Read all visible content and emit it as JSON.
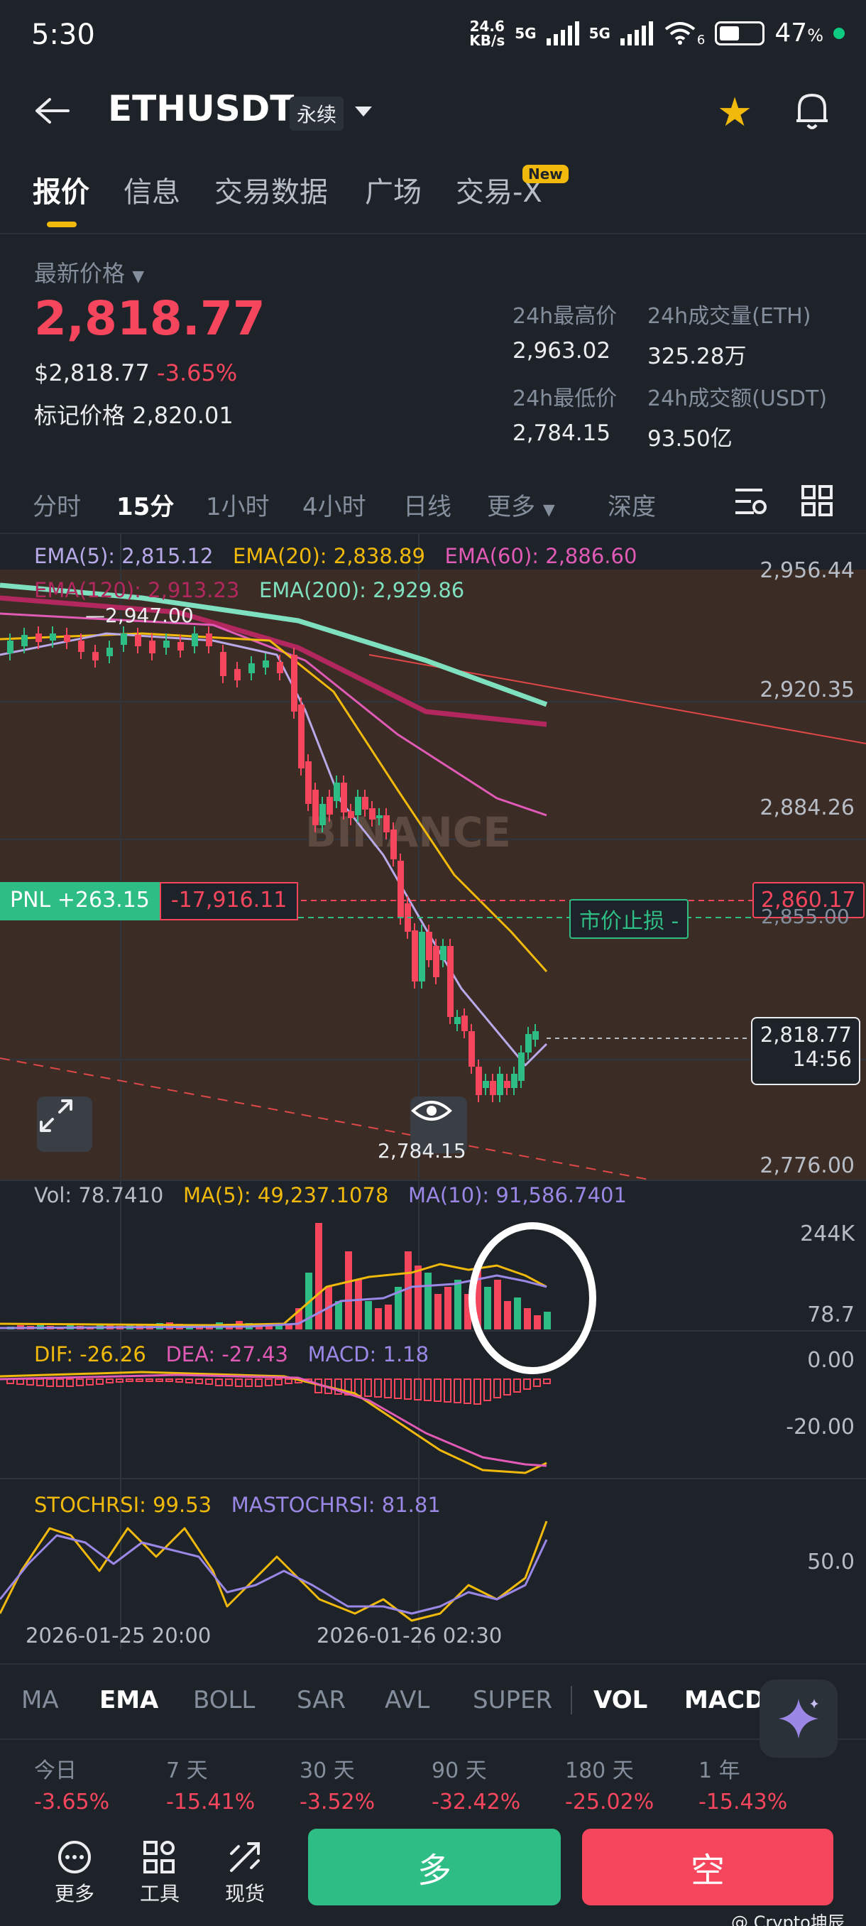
{
  "status_bar": {
    "time": "5:30",
    "net_speed_value": "24.6",
    "net_speed_unit": "KB/s",
    "signal1": "5G",
    "signal2": "5G",
    "wifi_badge": "6",
    "battery_percent": "47",
    "battery_unit": "%",
    "battery_level": 0.47
  },
  "header": {
    "symbol": "ETHUSDT",
    "contract_type": "永续"
  },
  "tabs": [
    {
      "label": "报价",
      "active": true
    },
    {
      "label": "信息"
    },
    {
      "label": "交易数据"
    },
    {
      "label": "广场"
    },
    {
      "label": "交易-X",
      "badge": "New"
    }
  ],
  "price": {
    "latest_label": "最新价格",
    "latest": "2,818.77",
    "usd": "$2,818.77",
    "change": "-3.65%",
    "mark_label": "标记价格",
    "mark": "2,820.01",
    "high_label": "24h最高价",
    "high": "2,963.02",
    "vol_eth_label": "24h成交量(ETH)",
    "vol_eth": "325.28万",
    "low_label": "24h最低价",
    "low": "2,784.15",
    "vol_usdt_label": "24h成交额(USDT)",
    "vol_usdt": "93.50亿"
  },
  "timeframes": [
    {
      "label": "分时"
    },
    {
      "label": "15分",
      "active": true
    },
    {
      "label": "1小时"
    },
    {
      "label": "4小时"
    },
    {
      "label": "日线"
    },
    {
      "label": "更多"
    },
    {
      "label": "深度"
    }
  ],
  "chart": {
    "ema5": "EMA(5): 2,815.12",
    "ema20": "EMA(20): 2,838.89",
    "ema60": "EMA(60): 2,886.60",
    "ema120": "EMA(120): 2,913.23",
    "ema200": "EMA(200): 2,929.86",
    "price_ticks": [
      "2,956.44",
      "2,920.35",
      "2,884.26",
      "2,776.00"
    ],
    "high_marker": "2,947.00",
    "low_marker": "2,784.15",
    "watermark": "BINANCE",
    "pnl_label": "PNL +263.15",
    "position_value": "-17,916.11",
    "position_price": "2,860.17",
    "stop_label": "市价止损 -",
    "stop_price": "2,855.00",
    "current_price": "2,818.77",
    "countdown": "14:56",
    "vol_legend": "Vol: 78.7410",
    "vol_ma5": "MA(5): 49,237.1078",
    "vol_ma10": "MA(10): 91,586.7401",
    "vol_ticks": [
      "244K",
      "78.7"
    ],
    "dif": "DIF: -26.26",
    "dea": "DEA: -27.43",
    "macd": "MACD: 1.18",
    "macd_ticks": [
      "0.00",
      "-20.00"
    ],
    "stochrsi": "STOCHRSI: 99.53",
    "mastochrsi": "MASTOCHRSI: 81.81",
    "stoch_tick": "50.0",
    "time_labels": [
      "2026-01-25 20:00",
      "2026-01-26 02:30"
    ],
    "colors": {
      "ema5": "#b8a9e8",
      "ema20": "#f0b90b",
      "ema60": "#e05ab6",
      "ema120": "#b3275f",
      "ema200": "#7fe0c0",
      "up": "#2ebd85",
      "down": "#f6465d"
    }
  },
  "indicator_tabs": [
    {
      "label": "MA"
    },
    {
      "label": "EMA",
      "active": true
    },
    {
      "label": "BOLL"
    },
    {
      "label": "SAR"
    },
    {
      "label": "AVL"
    },
    {
      "label": "SUPER"
    },
    {
      "label": "VOL",
      "active": true
    },
    {
      "label": "MACD",
      "active": true
    }
  ],
  "periods": [
    {
      "label": "今日",
      "value": "-3.65%"
    },
    {
      "label": "7 天",
      "value": "-15.41%"
    },
    {
      "label": "30 天",
      "value": "-3.52%"
    },
    {
      "label": "90 天",
      "value": "-32.42%"
    },
    {
      "label": "180 天",
      "value": "-25.02%"
    },
    {
      "label": "1 年",
      "value": "-15.43%"
    }
  ],
  "bottom": {
    "more": "更多",
    "tools": "工具",
    "spot": "现货",
    "long": "多",
    "short": "空",
    "watermark": "@ Crypto坤辰"
  }
}
